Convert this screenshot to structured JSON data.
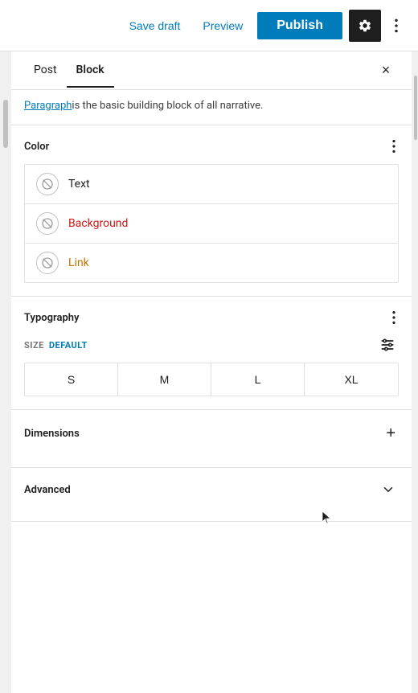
{
  "toolbar": {
    "save_draft_label": "Save draft",
    "preview_label": "Preview",
    "publish_label": "Publish",
    "settings_icon": "gear",
    "more_icon": "ellipsis-vertical"
  },
  "tabs": {
    "post_label": "Post",
    "block_label": "Block",
    "active": "Block",
    "close_label": "×"
  },
  "intro": {
    "text": "is the basic building block of all narrative."
  },
  "color_section": {
    "title": "Color",
    "more_label": "⋮",
    "items": [
      {
        "label": "Text",
        "style": "normal"
      },
      {
        "label": "Background",
        "style": "background"
      },
      {
        "label": "Link",
        "style": "link"
      }
    ]
  },
  "typography_section": {
    "title": "Typography",
    "more_label": "⋮",
    "size_label": "SIZE",
    "size_default_label": "DEFAULT",
    "filter_icon": "sliders",
    "font_sizes": [
      "S",
      "M",
      "L",
      "XL"
    ]
  },
  "dimensions_section": {
    "title": "Dimensions",
    "add_label": "+"
  },
  "advanced_section": {
    "title": "Advanced",
    "chevron_label": "∨"
  }
}
